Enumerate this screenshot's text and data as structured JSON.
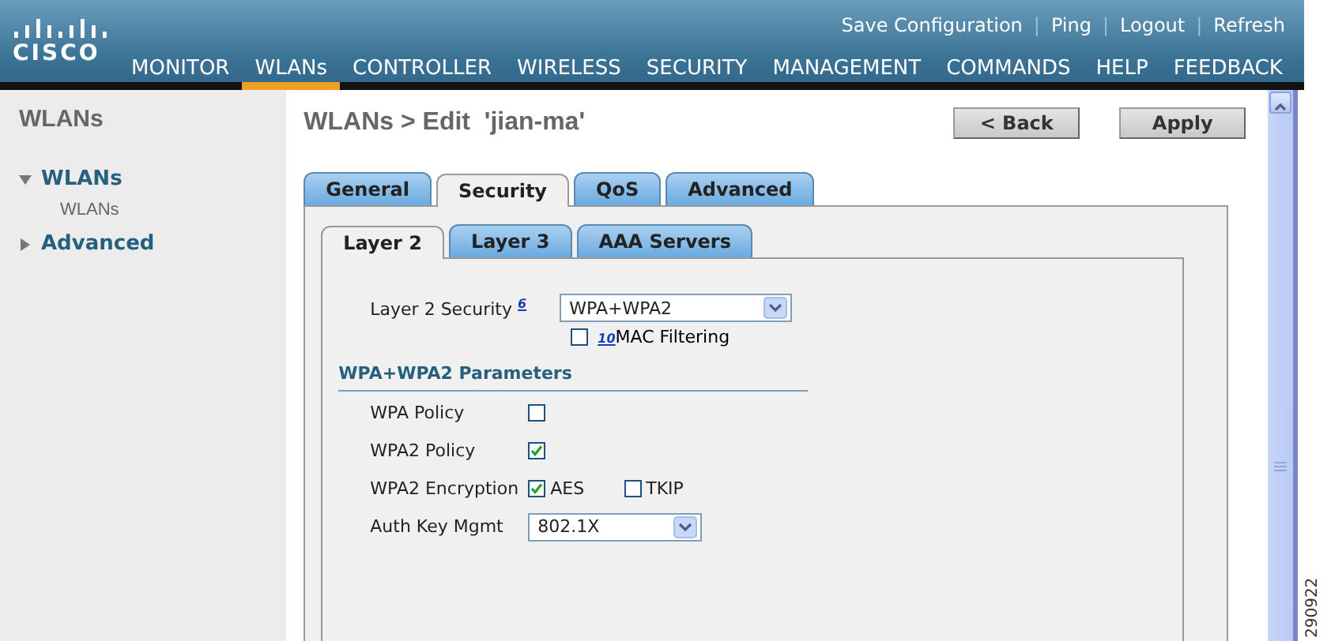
{
  "header": {
    "logo_text": "CISCO",
    "top_links": [
      {
        "label": "Save Configuration"
      },
      {
        "label": "Ping"
      },
      {
        "label": "Logout"
      },
      {
        "label": "Refresh"
      }
    ],
    "link_separator": "|",
    "nav": [
      {
        "label": "MONITOR",
        "selected": false
      },
      {
        "label": "WLANs",
        "selected": true
      },
      {
        "label": "CONTROLLER",
        "selected": false
      },
      {
        "label": "WIRELESS",
        "selected": false
      },
      {
        "label": "SECURITY",
        "selected": false
      },
      {
        "label": "MANAGEMENT",
        "selected": false
      },
      {
        "label": "COMMANDS",
        "selected": false
      },
      {
        "label": "HELP",
        "selected": false
      },
      {
        "label": "FEEDBACK",
        "selected": false
      }
    ]
  },
  "sidebar": {
    "title": "WLANs",
    "items": [
      {
        "label": "WLANs",
        "expanded": true,
        "children": [
          {
            "label": "WLANs"
          }
        ]
      },
      {
        "label": "Advanced",
        "expanded": false
      }
    ]
  },
  "page": {
    "title": "WLANs > Edit  'jian-ma'",
    "buttons": [
      "< Back",
      "Apply"
    ]
  },
  "tabs": [
    {
      "label": "General",
      "selected": false
    },
    {
      "label": "Security",
      "selected": true
    },
    {
      "label": "QoS",
      "selected": false
    },
    {
      "label": "Advanced",
      "selected": false
    }
  ],
  "subtabs": [
    {
      "label": "Layer 2",
      "selected": true
    },
    {
      "label": "Layer 3",
      "selected": false
    },
    {
      "label": "AAA Servers",
      "selected": false
    }
  ],
  "layer2": {
    "label": "Layer 2 Security",
    "note": "6",
    "value": "WPA+WPA2",
    "mac_filtering": {
      "label": "MAC Filtering",
      "note": "10",
      "checked": false
    }
  },
  "parameters": {
    "title": "WPA+WPA2 Parameters",
    "rows": [
      {
        "kind": "checkbox",
        "label": "WPA Policy",
        "checked": false
      },
      {
        "kind": "checkbox",
        "label": "WPA2 Policy",
        "checked": true
      },
      {
        "kind": "options",
        "label": "WPA2 Encryption",
        "options": [
          {
            "label": "AES",
            "checked": true
          },
          {
            "label": "TKIP",
            "checked": false
          }
        ]
      },
      {
        "kind": "select",
        "label": "Auth Key Mgmt",
        "value": "802.1X"
      }
    ]
  },
  "figure_number": "290922"
}
